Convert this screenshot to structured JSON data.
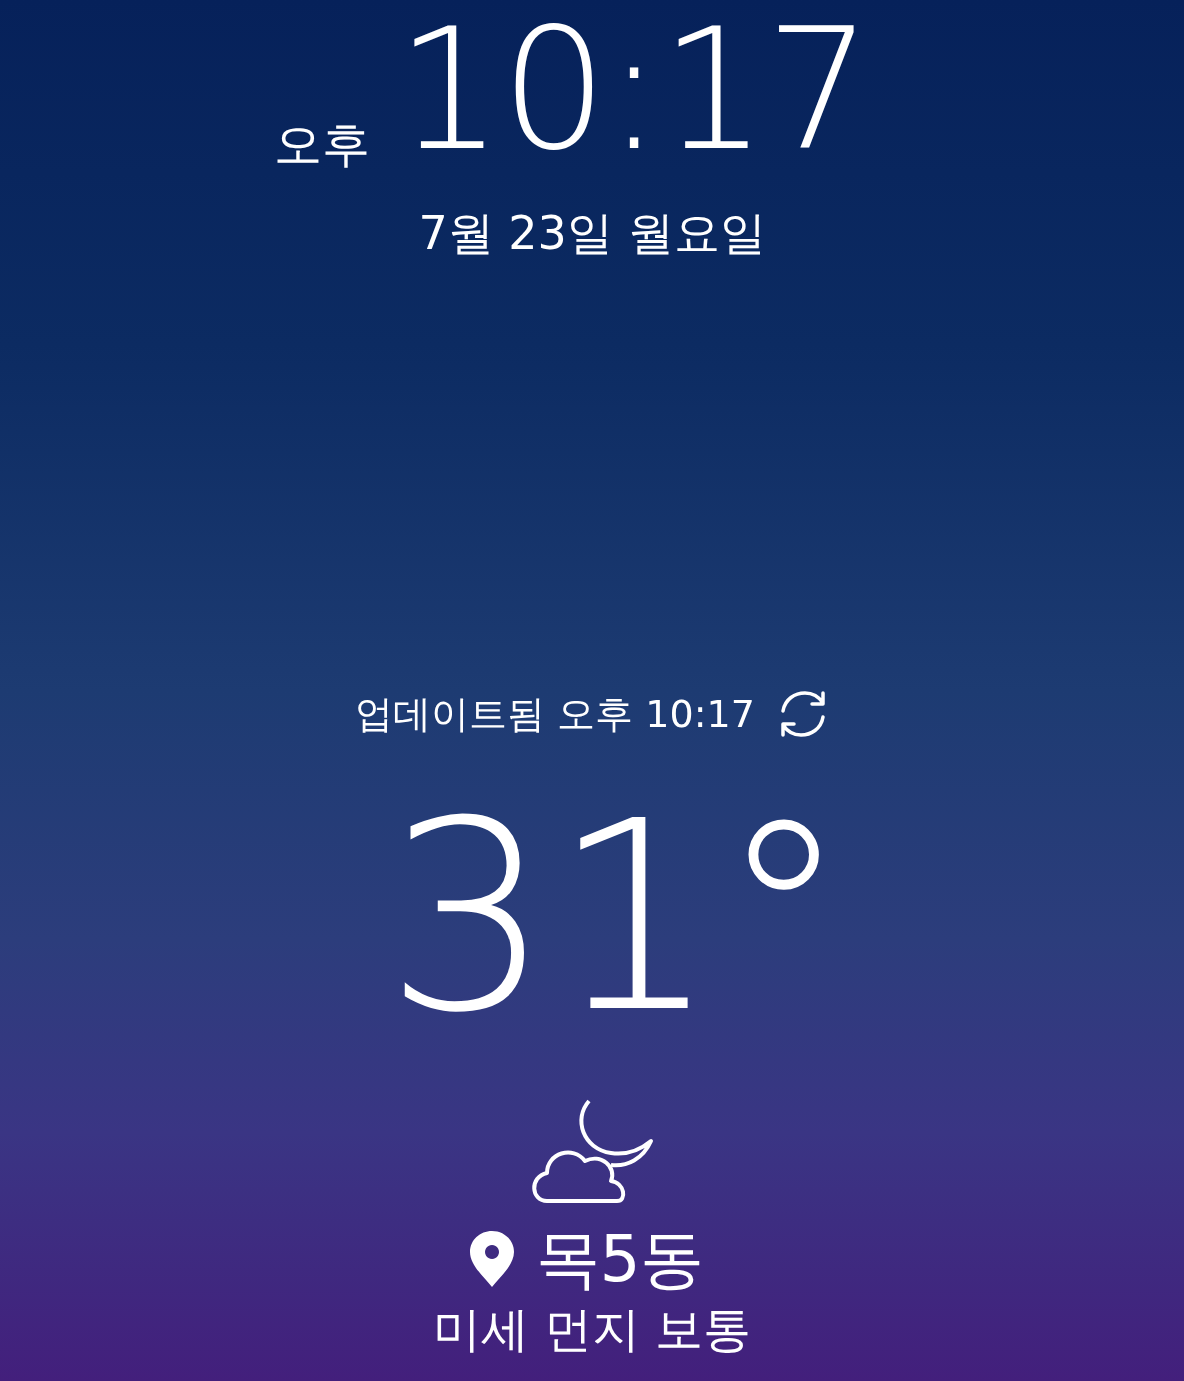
{
  "clock": {
    "period": "오후",
    "time": "10:17"
  },
  "date": "7월 23일 월요일",
  "weather": {
    "updated": "업데이트됨 오후 10:17",
    "temperature": "31°",
    "icon": {
      "kind": "partly-cloudy-night"
    },
    "location": "목5동",
    "air_quality": "미세 먼지 보통"
  }
}
